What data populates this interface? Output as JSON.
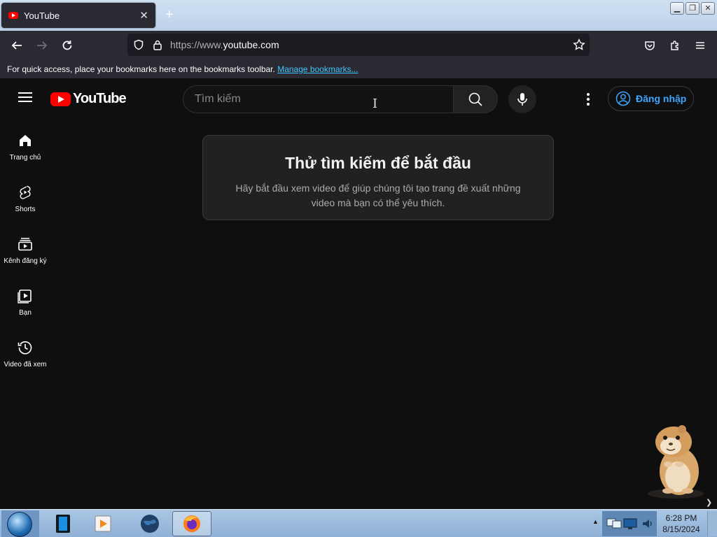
{
  "browser": {
    "tab_title": "YouTube",
    "tab_close": "✕",
    "new_tab": "+",
    "url_scheme": "https://www.",
    "url_host": "youtube.com",
    "bookmarks_message": "For quick access, place your bookmarks here on the bookmarks toolbar.",
    "bookmarks_link": "Manage bookmarks..."
  },
  "youtube": {
    "logo_text": "YouTube",
    "search_placeholder": "Tìm kiếm",
    "signin_label": "Đăng nhập",
    "sidebar": [
      {
        "label": "Trang chủ",
        "icon": "home-icon"
      },
      {
        "label": "Shorts",
        "icon": "shorts-icon"
      },
      {
        "label": "Kênh đăng ký",
        "icon": "subscriptions-icon"
      },
      {
        "label": "Bạn",
        "icon": "you-icon"
      },
      {
        "label": "Video đã xem",
        "icon": "history-icon"
      }
    ],
    "empty_state": {
      "title": "Thử tìm kiếm để bắt đầu",
      "message": "Hãy bắt đầu xem video để giúp chúng tôi tạo trang đề xuất những video mà bạn có thể yêu thích."
    }
  },
  "taskbar": {
    "time": "6:28 PM",
    "date": "8/15/2024"
  },
  "colors": {
    "yt_background": "#0f0f0f",
    "yt_red": "#ff0000",
    "link_blue": "#3ea6ff",
    "browser_chrome": "#2b2a33"
  }
}
